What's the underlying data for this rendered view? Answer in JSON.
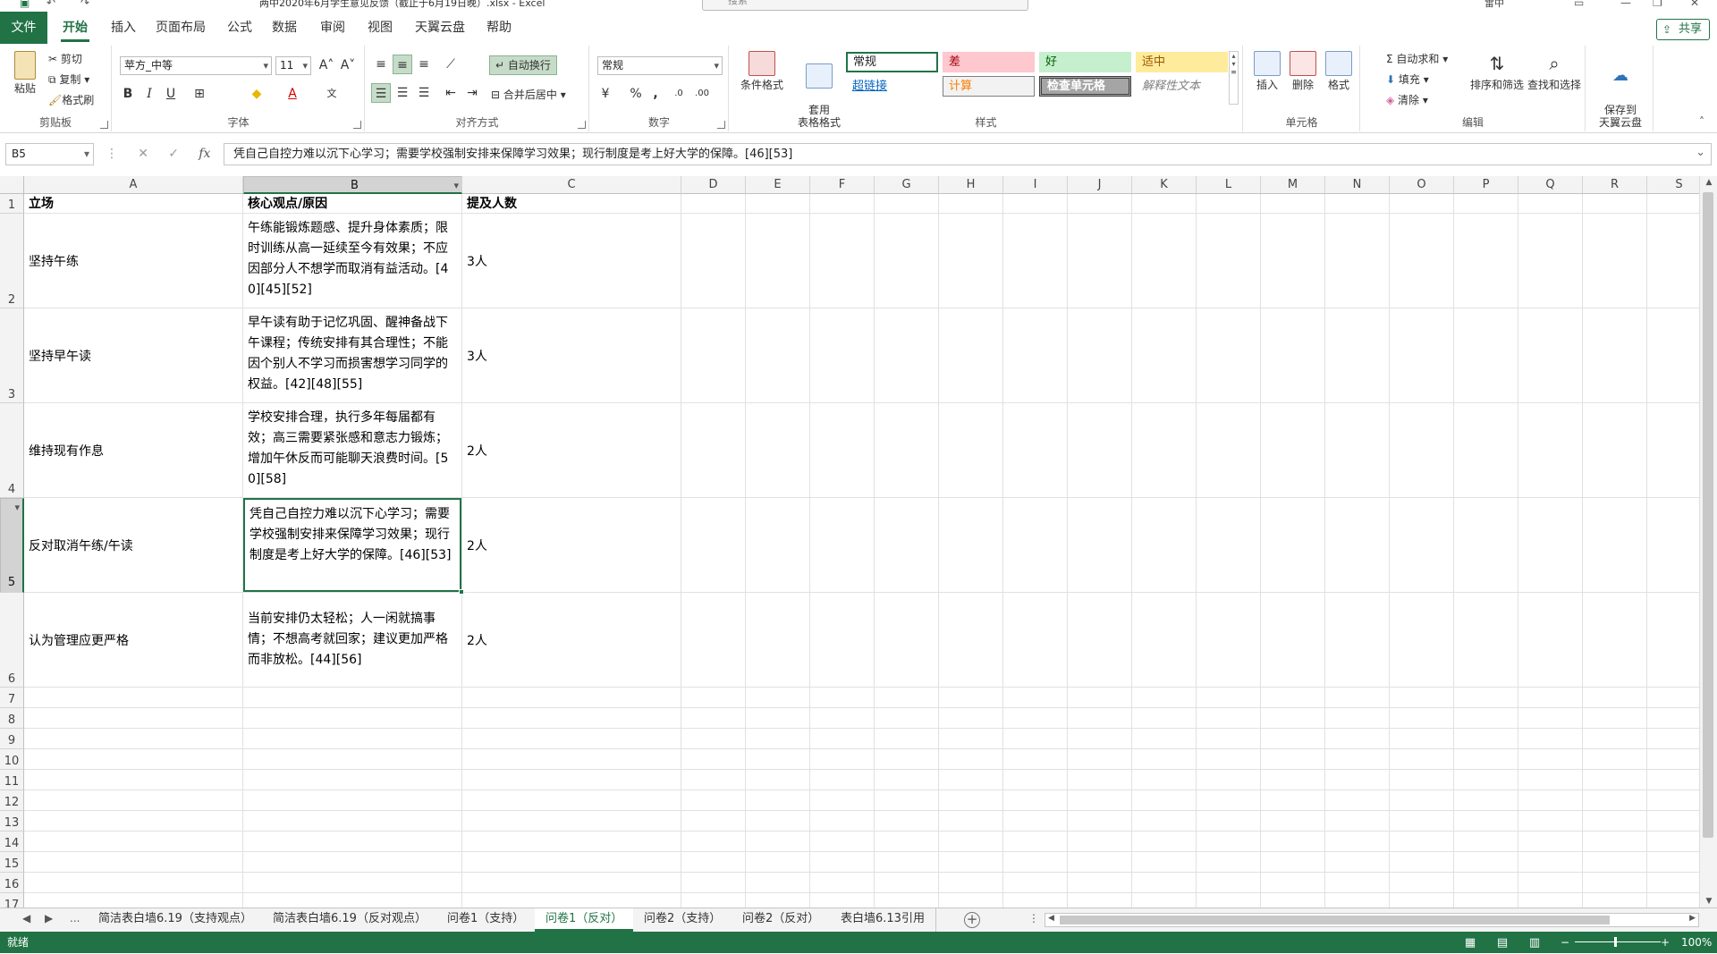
{
  "window": {
    "title": "两中2020年6月学生意见反馈（截止于6月19日晚）.xlsx  -  Excel",
    "search_placeholder": "搜索",
    "user": "雷中"
  },
  "menu": {
    "file": "文件",
    "tabs": [
      "开始",
      "插入",
      "页面布局",
      "公式",
      "数据",
      "审阅",
      "视图",
      "天翼云盘",
      "帮助"
    ],
    "active_tab": "开始",
    "share": "共享"
  },
  "ribbon": {
    "clipboard": {
      "label": "剪贴板",
      "paste": "粘贴",
      "cut": "剪切",
      "copy": "复制",
      "format_painter": "格式刷"
    },
    "font": {
      "label": "字体",
      "font_name": "苹方_中等",
      "font_size": "11",
      "bold": "B",
      "italic": "I",
      "underline": "U"
    },
    "alignment": {
      "label": "对齐方式",
      "wrap_text": "自动换行",
      "merge_center": "合并后居中"
    },
    "number": {
      "label": "数字",
      "format": "常规"
    },
    "styles": {
      "label": "样式",
      "conditional": "条件格式",
      "table": "套用\n表格格式",
      "normal": "常规",
      "bad": "差",
      "good": "好",
      "neutral": "适中",
      "hyperlink": "超链接",
      "calculation": "计算",
      "check_cell": "检查单元格",
      "explanatory": "解释性文本"
    },
    "cells": {
      "label": "单元格",
      "insert": "插入",
      "delete": "删除",
      "format": "格式"
    },
    "editing": {
      "label": "编辑",
      "autosum": "自动求和",
      "fill": "填充",
      "clear": "清除",
      "sort_filter": "排序和筛选",
      "find_select": "查找和选择"
    },
    "cloud": {
      "save": "保存到\n天翼云盘"
    }
  },
  "formula_bar": {
    "name_box": "B5",
    "fx": "fx",
    "content": "凭自己自控力难以沉下心学习；需要学校强制安排来保障学习效果；现行制度是考上好大学的保障。[46][53]"
  },
  "sheet": {
    "columns": [
      "A",
      "B",
      "C",
      "D",
      "E",
      "F",
      "G",
      "H",
      "I",
      "J",
      "K",
      "L",
      "M",
      "N",
      "O",
      "P",
      "Q",
      "R",
      "S"
    ],
    "row_numbers": [
      "1",
      "2",
      "3",
      "4",
      "5",
      "6",
      "7",
      "8",
      "9",
      "10",
      "11",
      "12",
      "13",
      "14",
      "15",
      "16",
      "17"
    ],
    "header": {
      "a": "立场",
      "b": "核心观点/原因",
      "c": "提及人数"
    },
    "rows": [
      {
        "a": "坚持午练",
        "b": "午练能锻炼题感、提升身体素质；限时训练从高一延续至今有效果；不应因部分人不想学而取消有益活动。[40][45][52]",
        "c": "3人"
      },
      {
        "a": "坚持早午读",
        "b": "早午读有助于记忆巩固、醒神备战下午课程；传统安排有其合理性；不能因个别人不学习而损害想学习同学的权益。[42][48][55]",
        "c": "3人"
      },
      {
        "a": "维持现有作息",
        "b": "学校安排合理，执行多年每届都有效；高三需要紧张感和意志力锻炼；增加午休反而可能聊天浪费时间。[50][58]",
        "c": "2人"
      },
      {
        "a": "反对取消午练/午读",
        "b": "凭自己自控力难以沉下心学习；需要学校强制安排来保障学习效果；现行制度是考上好大学的保障。[46][53]",
        "c": "2人"
      },
      {
        "a": "认为管理应更严格",
        "b": "当前安排仍太轻松；人一闲就搞事情；不想高考就回家；建议更加严格而非放松。[44][56]",
        "c": "2人"
      }
    ]
  },
  "sheet_tabs": {
    "ellipsis": "...",
    "tabs": [
      "简洁表白墙6.19（支持观点）",
      "简洁表白墙6.19（反对观点）",
      "问卷1（支持）",
      "问卷1（反对）",
      "问卷2（支持）",
      "问卷2（反对）",
      "表白墙6.13引用"
    ],
    "active_index": 3
  },
  "status": {
    "ready": "就绪",
    "zoom": "100%"
  },
  "colors": {
    "accent": "#217346"
  }
}
